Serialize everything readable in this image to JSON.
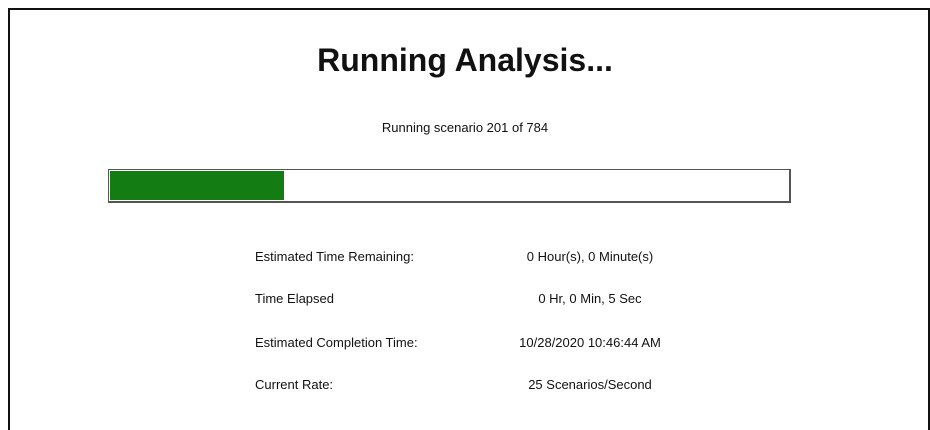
{
  "dialog": {
    "title": "Running Analysis...",
    "status": "Running scenario 201 of 784",
    "progress_fraction": 0.256
  },
  "stats": [
    {
      "label": "Estimated Time Remaining:",
      "value": "0 Hour(s), 0 Minute(s)"
    },
    {
      "label": "Time Elapsed",
      "value": "0 Hr, 0 Min, 5 Sec"
    },
    {
      "label": "Estimated Completion Time:",
      "value": "10/28/2020 10:46:44 AM"
    },
    {
      "label": "Current Rate:",
      "value": "25 Scenarios/Second"
    }
  ],
  "colors": {
    "progress_fill": "#137d13"
  }
}
